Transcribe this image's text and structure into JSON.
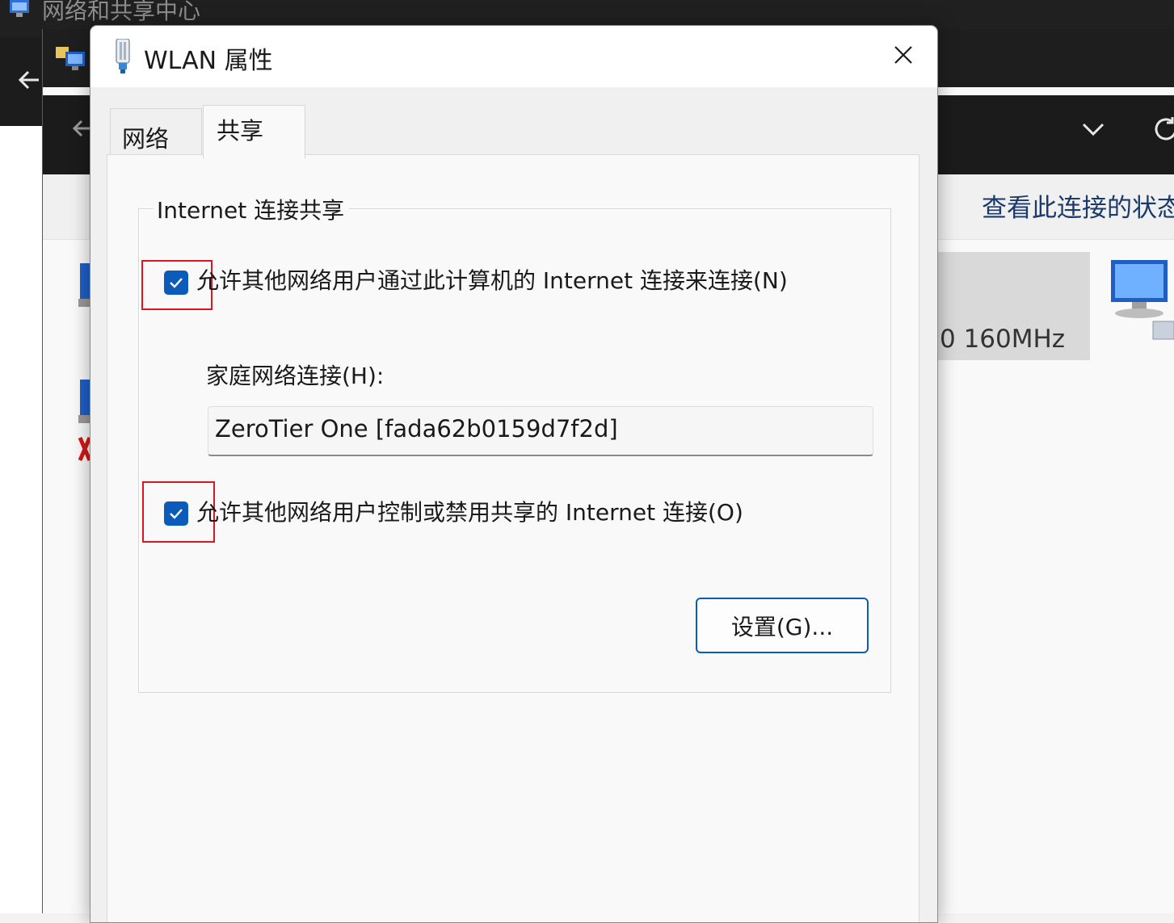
{
  "background": {
    "window_title": "网络和共享中心",
    "command_bar_fragment": "",
    "view_status_link": "查看此连接的状态",
    "adapter_detail_fragment": "0 160MHz"
  },
  "dialog": {
    "title": "WLAN 属性",
    "tabs": [
      {
        "label": "网络",
        "selected": false
      },
      {
        "label": "共享",
        "selected": true
      }
    ],
    "group_title": "Internet 连接共享",
    "allow_sharing": {
      "label": "允许其他网络用户通过此计算机的 Internet 连接来连接(N)",
      "checked": true
    },
    "home_connection": {
      "label": "家庭网络连接(H):",
      "value": "ZeroTier One [fada62b0159d7f2d]"
    },
    "allow_control": {
      "label": "允许其他网络用户控制或禁用共享的 Internet 连接(O)",
      "checked": true
    },
    "settings_button": "设置(G)..."
  },
  "colors": {
    "accent": "#0b5cba",
    "highlight": "#e0141c",
    "dark_chrome": "#1e1e1e"
  },
  "icons": [
    "network-center-icon",
    "computer-icon",
    "wlan-adapter-icon",
    "close-icon",
    "chevron-down-icon",
    "refresh-icon",
    "back-arrow-icon",
    "checkmark-icon",
    "network-adapter-icon"
  ]
}
